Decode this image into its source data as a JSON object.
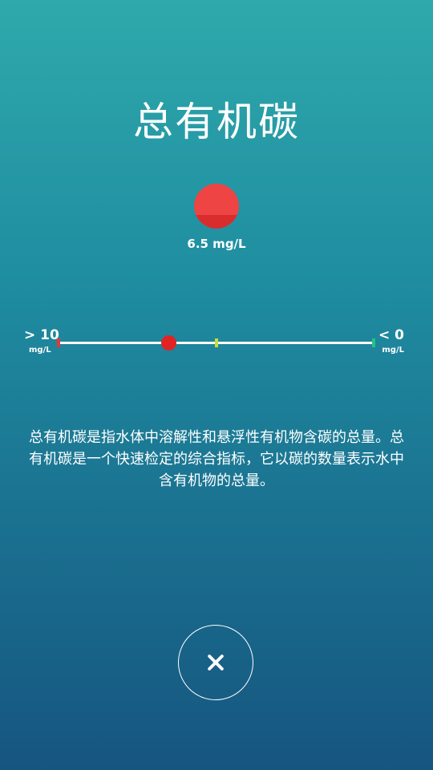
{
  "screen": {
    "title": "总有机碳",
    "description": "总有机碳是指水体中溶解性和悬浮性有机物含碳的总量。总有机碳是一个快速检定的综合指标，它以碳的数量表示水中含有机物的总量。"
  },
  "reading": {
    "value_text": "6.5 mg/L",
    "status_color": "#ef4444"
  },
  "scale": {
    "left_value": "> 10",
    "left_unit": "mg/L",
    "right_value": "< 0",
    "right_unit": "mg/L",
    "marker_value": 6.5,
    "min": 0,
    "max": 10,
    "tick_colors": {
      "high": "#e53935",
      "mid": "#cddc39",
      "low": "#26c281"
    }
  },
  "controls": {
    "close_icon": "close-icon"
  }
}
